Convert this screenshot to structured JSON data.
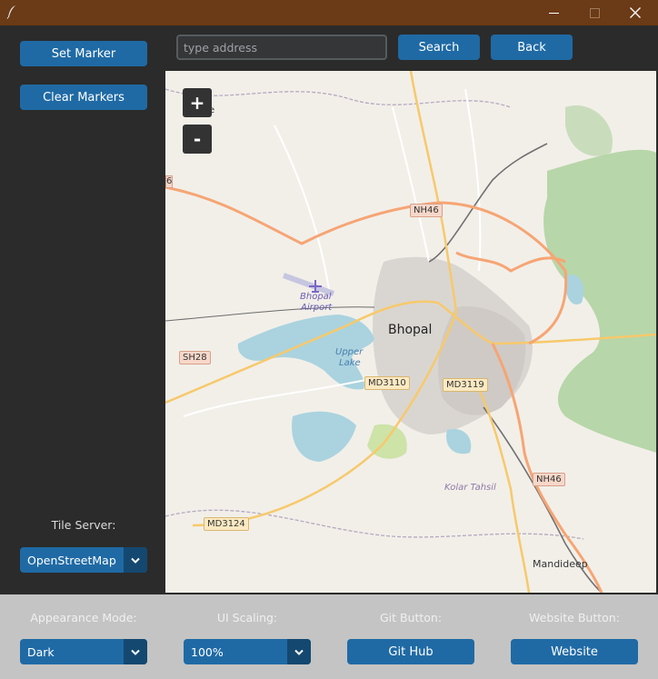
{
  "window": {
    "minimize_icon": "minimize-icon",
    "maximize_icon": "maximize-icon",
    "close_icon": "close-icon",
    "app_icon": "feather-icon"
  },
  "sidebar": {
    "set_marker_label": "Set Marker",
    "clear_markers_label": "Clear Markers",
    "tile_server_label": "Tile Server:",
    "tile_server_value": "OpenStreetMap"
  },
  "search": {
    "placeholder": "type address",
    "value": "",
    "search_label": "Search",
    "back_label": "Back"
  },
  "map": {
    "zoom_in_label": "+",
    "zoom_out_label": "-",
    "places": {
      "city": "Bhopal",
      "airport_line1": "Bhopal",
      "airport_line2": "Airport",
      "lake_line1": "Upper",
      "lake_line2": "Lake",
      "tehsil": "Kolar Tahsil",
      "town": "Mandideep",
      "partial_left": "6",
      "partial_top": "e"
    },
    "road_labels": {
      "nh46_top": "NH46",
      "nh46_bottom": "NH46",
      "sh28": "SH28",
      "md3110": "MD3110",
      "md3119": "MD3119",
      "md3124": "MD3124"
    }
  },
  "bottom": {
    "appearance_label": "Appearance Mode:",
    "appearance_value": "Dark",
    "scaling_label": "UI Scaling:",
    "scaling_value": "100%",
    "git_label": "Git Button:",
    "git_button": "Git Hub",
    "website_label": "Website Button:",
    "website_button": "Website"
  },
  "colors": {
    "accent": "#1f6aa5",
    "accent_dark": "#144870",
    "titlebar": "#6b3a17",
    "panel": "#2b2b2b",
    "bottom_panel": "#c4c4c4",
    "map_land": "#f2efe9",
    "water": "#aad3df",
    "primary_road": "#f6a574",
    "secondary_road": "#f7c96b"
  }
}
